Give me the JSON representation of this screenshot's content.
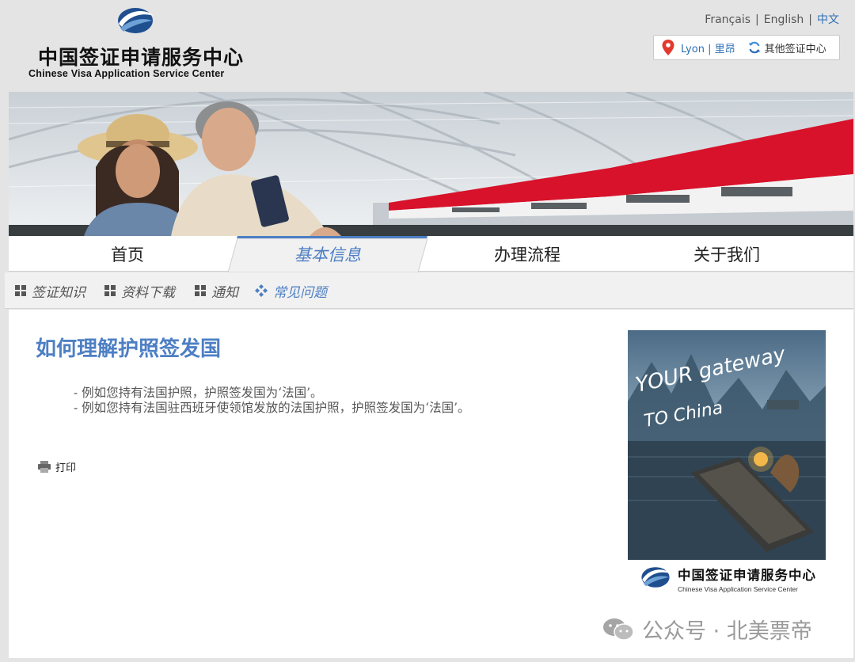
{
  "header": {
    "logo_cn": "中国签证申请服务中心",
    "logo_en": "Chinese Visa Application Service Center",
    "languages": [
      "Français",
      "English",
      "中文"
    ],
    "active_language": "中文",
    "center": {
      "city": "Lyon | 里昂",
      "other_centers": "其他签证中心"
    }
  },
  "nav": {
    "items": [
      "首页",
      "基本信息",
      "办理流程",
      "关于我们"
    ],
    "active": "基本信息"
  },
  "subnav": {
    "items": [
      "签证知识",
      "资料下载",
      "通知",
      "常见问题"
    ],
    "active": "常见问题"
  },
  "article": {
    "title": "如何理解护照签发国",
    "lines": [
      "- 例如您持有法国护照，护照签发国为‘法国’。",
      "- 例如您持有法国驻西班牙使领馆发放的法国护照，护照签发国为‘法国’。"
    ],
    "print_label": "打印"
  },
  "poster": {
    "text_line1": "YOUR gateway",
    "text_line2": "TO China",
    "logo_cn": "中国签证申请服务中心",
    "logo_en": "Chinese Visa Application Service Center"
  },
  "watermark": "公众号 · 北美票帝",
  "colors": {
    "accent": "#4d7fc4",
    "link": "#2f6fb5",
    "page_bg": "#e4e4e4"
  }
}
